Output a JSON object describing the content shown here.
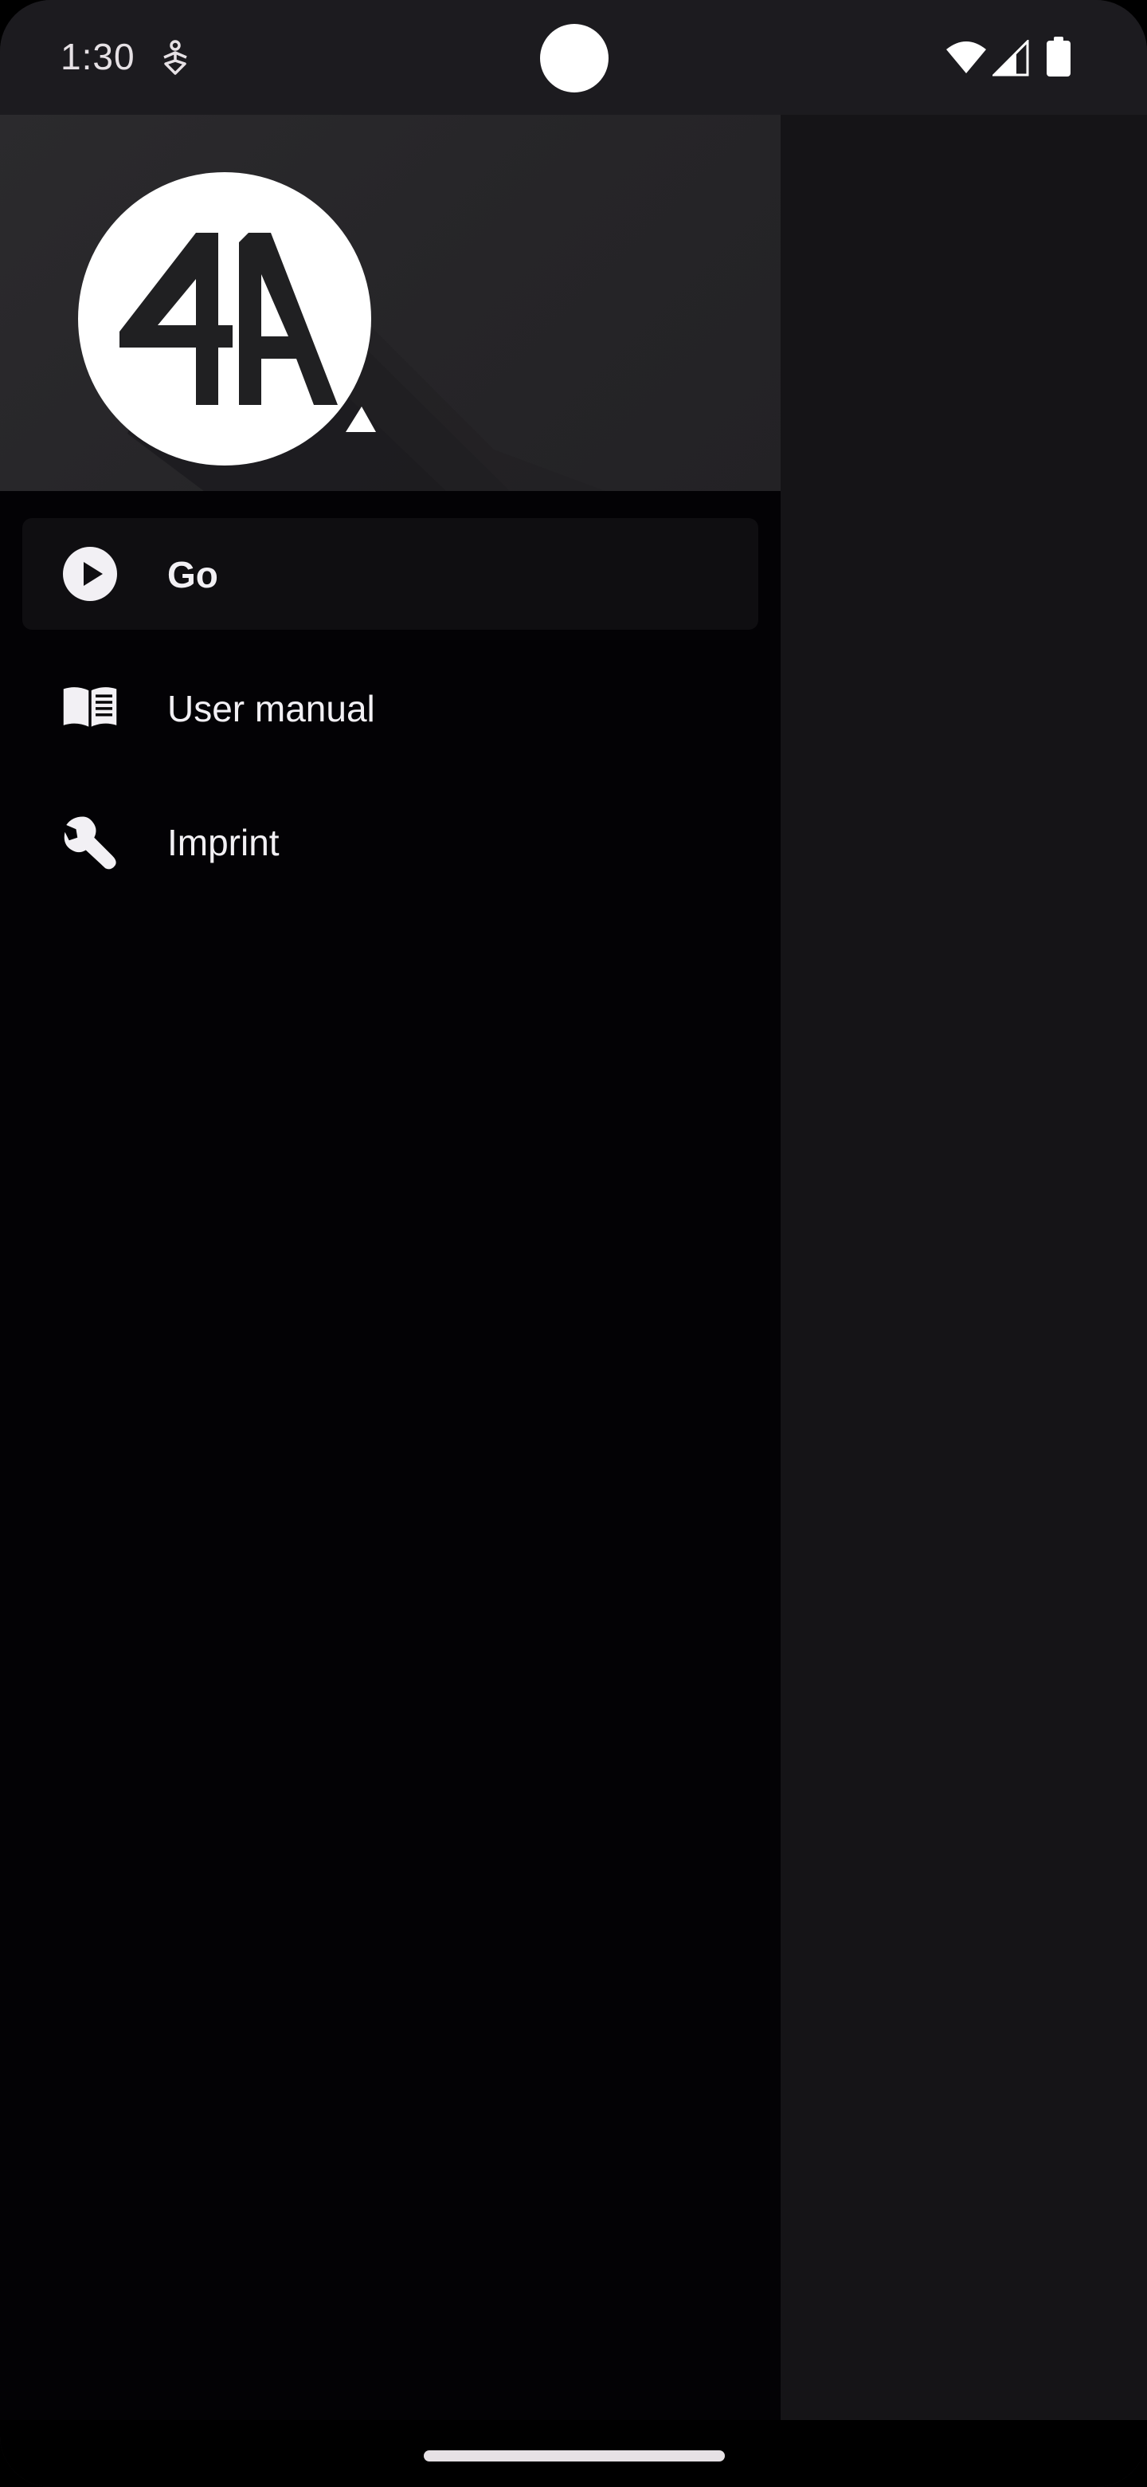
{
  "status_bar": {
    "time": "1:30",
    "notification_icon": "accessibility-service-icon",
    "wifi_icon": "wifi-icon",
    "signal_icon": "cell-signal-icon",
    "battery_icon": "battery-full-icon"
  },
  "drawer": {
    "header": {
      "logo_icon": "app-logo-4a",
      "logo_text": "4A"
    },
    "items": [
      {
        "label": "Go",
        "icon": "play-circle-icon",
        "selected": true
      },
      {
        "label": "User manual",
        "icon": "open-book-icon",
        "selected": false
      },
      {
        "label": "Imprint",
        "icon": "wrench-icon",
        "selected": false
      }
    ]
  },
  "colors": {
    "drawer_background": "#030205",
    "header_background": "#2b2a2d",
    "selected_item_background": "#0f0e11",
    "scrim": "#151417",
    "text": "#f2f0f4"
  }
}
